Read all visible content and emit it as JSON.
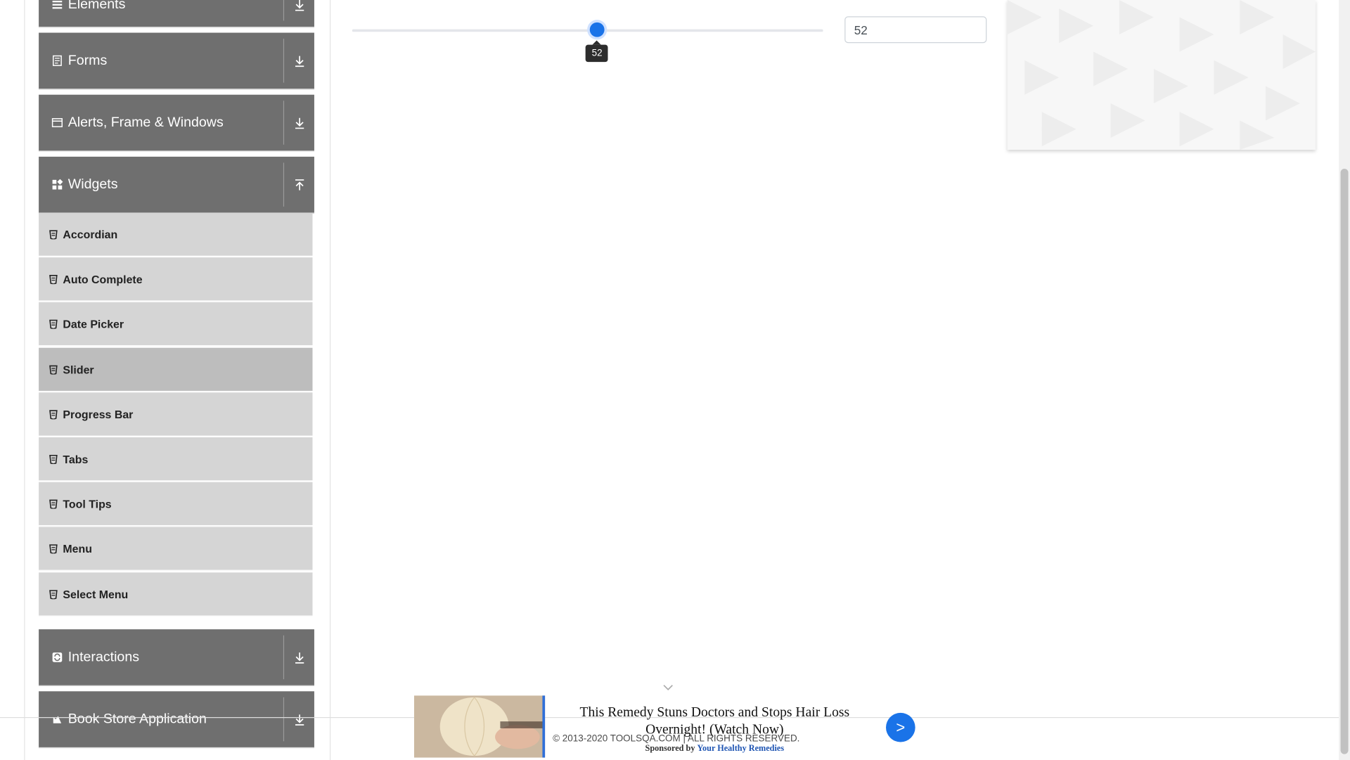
{
  "nav": {
    "groups": [
      {
        "label": "Elements"
      },
      {
        "label": "Forms"
      },
      {
        "label": "Alerts, Frame & Windows"
      },
      {
        "label": "Widgets"
      },
      {
        "label": "Interactions"
      },
      {
        "label": "Book Store Application"
      }
    ],
    "widget_items": [
      {
        "label": "Accordian"
      },
      {
        "label": "Auto Complete"
      },
      {
        "label": "Date Picker"
      },
      {
        "label": "Slider"
      },
      {
        "label": "Progress Bar"
      },
      {
        "label": "Tabs"
      },
      {
        "label": "Tool Tips"
      },
      {
        "label": "Menu"
      },
      {
        "label": "Select Menu"
      }
    ],
    "active_item": "Slider"
  },
  "slider": {
    "value": 52,
    "min": 0,
    "max": 100,
    "tooltip": "52",
    "input_value": "52",
    "accent_color": "#1a73e8"
  },
  "footer": {
    "copyright": "© 2013-2020 TOOLSQA.COM | ALL RIGHTS RESERVED."
  },
  "ad": {
    "headline": "This Remedy Stuns Doctors and Stops Hair Loss Overnight! (Watch Now)",
    "sponsor_prefix": "Sponsored by",
    "sponsor_name": "Your Healthy Remedies",
    "next_label": ">"
  }
}
